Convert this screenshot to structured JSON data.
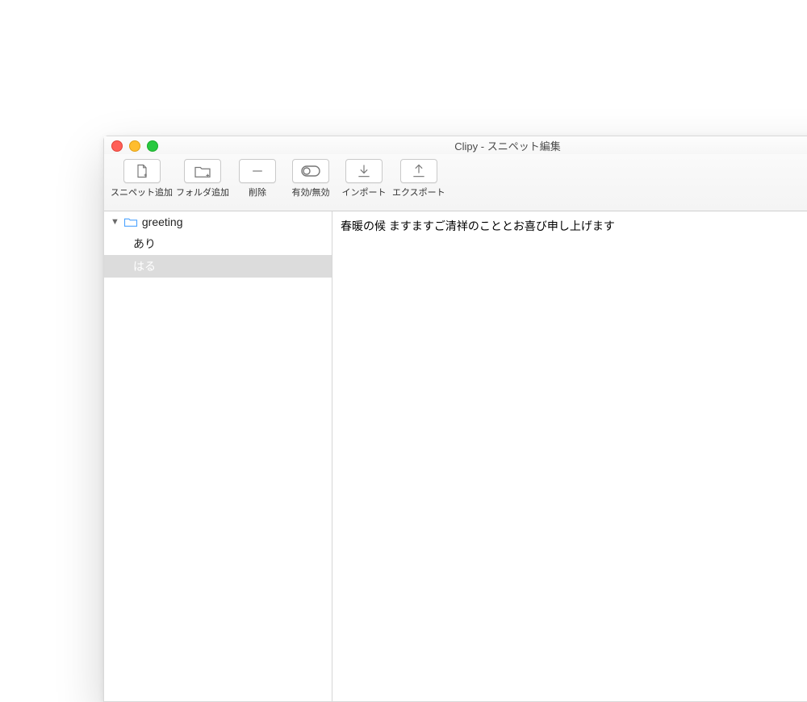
{
  "window": {
    "title": "Clipy - スニペット編集"
  },
  "toolbar": {
    "add_snippet": "スニペット追加",
    "add_folder": "フォルダ追加",
    "delete": "削除",
    "toggle": "有効/無効",
    "import": "インポート",
    "export": "エクスポート"
  },
  "sidebar": {
    "folder_name": "greeting",
    "items": [
      {
        "label": "あり",
        "selected": false
      },
      {
        "label": "はる",
        "selected": true
      }
    ]
  },
  "editor": {
    "content": "春暖の候 ますますご清祥のこととお喜び申し上げます"
  }
}
